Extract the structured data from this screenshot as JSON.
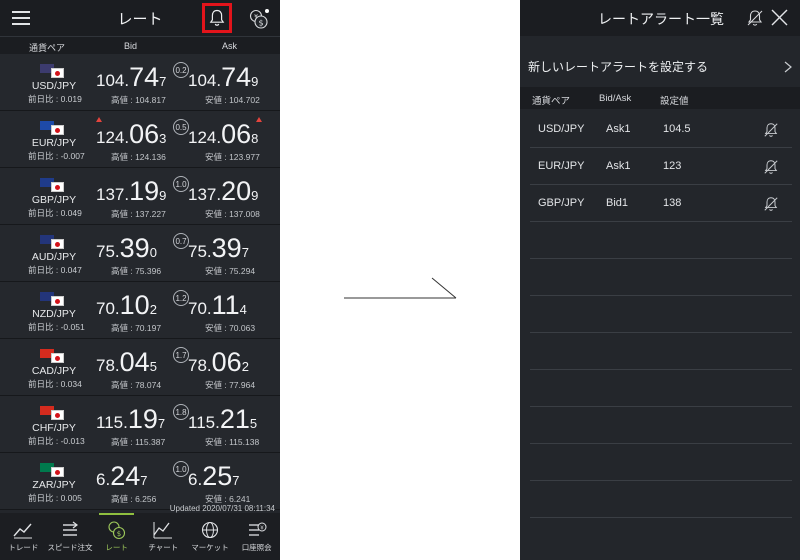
{
  "left": {
    "title": "レート",
    "columns": {
      "pair": "通貨ペア",
      "bid": "Bid",
      "ask": "Ask"
    },
    "rows": [
      {
        "pair": "USD/JPY",
        "diff": "前日比 : 0.019",
        "bid_a": "104.",
        "bid_b": "74",
        "bid_c": "7",
        "spread": "0.2",
        "ask_a": "104.",
        "ask_b": "74",
        "ask_c": "9",
        "high": "高値 : 104.817",
        "low": "安値 : 104.702",
        "up_bid": false,
        "up_ask": false,
        "flag_color": "#3c3b6e"
      },
      {
        "pair": "EUR/JPY",
        "diff": "前日比 : -0.007",
        "bid_a": "124.",
        "bid_b": "06",
        "bid_c": "3",
        "spread": "0.5",
        "ask_a": "124.",
        "ask_b": "06",
        "ask_c": "8",
        "high": "高値 : 124.136",
        "low": "安値 : 123.977",
        "up_bid": true,
        "up_ask": true,
        "flag_color": "#1e4aa8"
      },
      {
        "pair": "GBP/JPY",
        "diff": "前日比 : 0.049",
        "bid_a": "137.",
        "bid_b": "19",
        "bid_c": "9",
        "spread": "1.0",
        "ask_a": "137.",
        "ask_b": "20",
        "ask_c": "9",
        "high": "高値 : 137.227",
        "low": "安値 : 137.008",
        "up_bid": false,
        "up_ask": false,
        "flag_color": "#1f3b8a"
      },
      {
        "pair": "AUD/JPY",
        "diff": "前日比 : 0.047",
        "bid_a": "75.",
        "bid_b": "39",
        "bid_c": "0",
        "spread": "0.7",
        "ask_a": "75.",
        "ask_b": "39",
        "ask_c": "7",
        "high": "高値 : 75.396",
        "low": "安値 : 75.294",
        "up_bid": false,
        "up_ask": false,
        "flag_color": "#23357a"
      },
      {
        "pair": "NZD/JPY",
        "diff": "前日比 : -0.051",
        "bid_a": "70.",
        "bid_b": "10",
        "bid_c": "2",
        "spread": "1.2",
        "ask_a": "70.",
        "ask_b": "11",
        "ask_c": "4",
        "high": "高値 : 70.197",
        "low": "安値 : 70.063",
        "up_bid": false,
        "up_ask": false,
        "flag_color": "#23357a"
      },
      {
        "pair": "CAD/JPY",
        "diff": "前日比 : 0.034",
        "bid_a": "78.",
        "bid_b": "04",
        "bid_c": "5",
        "spread": "1.7",
        "ask_a": "78.",
        "ask_b": "06",
        "ask_c": "2",
        "high": "高値 : 78.074",
        "low": "安値 : 77.964",
        "up_bid": false,
        "up_ask": false,
        "flag_color": "#d52b1e"
      },
      {
        "pair": "CHF/JPY",
        "diff": "前日比 : -0.013",
        "bid_a": "115.",
        "bid_b": "19",
        "bid_c": "7",
        "spread": "1.8",
        "ask_a": "115.",
        "ask_b": "21",
        "ask_c": "5",
        "high": "高値 : 115.387",
        "low": "安値 : 115.138",
        "up_bid": false,
        "up_ask": false,
        "flag_color": "#d52b1e"
      },
      {
        "pair": "ZAR/JPY",
        "diff": "前日比 : 0.005",
        "bid_a": "6.",
        "bid_b": "24",
        "bid_c": "7",
        "spread": "1.0",
        "ask_a": "6.",
        "ask_b": "25",
        "ask_c": "7",
        "high": "高値 : 6.256",
        "low": "安値 : 6.241",
        "up_bid": false,
        "up_ask": false,
        "flag_color": "#007a4d"
      }
    ],
    "updated": "Updated  2020/07/31 08:11:34",
    "tabs": [
      {
        "label": "トレード",
        "icon": "trade-chart-icon",
        "active": false
      },
      {
        "label": "スピード注文",
        "icon": "speed-order-icon",
        "active": false
      },
      {
        "label": "レート",
        "icon": "rate-coin-icon",
        "active": true
      },
      {
        "label": "チャート",
        "icon": "chart-icon",
        "active": false
      },
      {
        "label": "マーケット",
        "icon": "globe-icon",
        "active": false
      },
      {
        "label": "口座照会",
        "icon": "account-icon",
        "active": false
      }
    ],
    "highlight_color": "#e3141b"
  },
  "right": {
    "title": "レートアラート一覧",
    "new_alert": "新しいレートアラートを設定する",
    "columns": {
      "pair": "通貨ペア",
      "side": "Bid/Ask",
      "value": "設定値"
    },
    "alerts": [
      {
        "pair": "USD/JPY",
        "side": "Ask1",
        "value": "104.5"
      },
      {
        "pair": "EUR/JPY",
        "side": "Ask1",
        "value": "123"
      },
      {
        "pair": "GBP/JPY",
        "side": "Bid1",
        "value": "138"
      }
    ],
    "empty_rows": 8
  }
}
